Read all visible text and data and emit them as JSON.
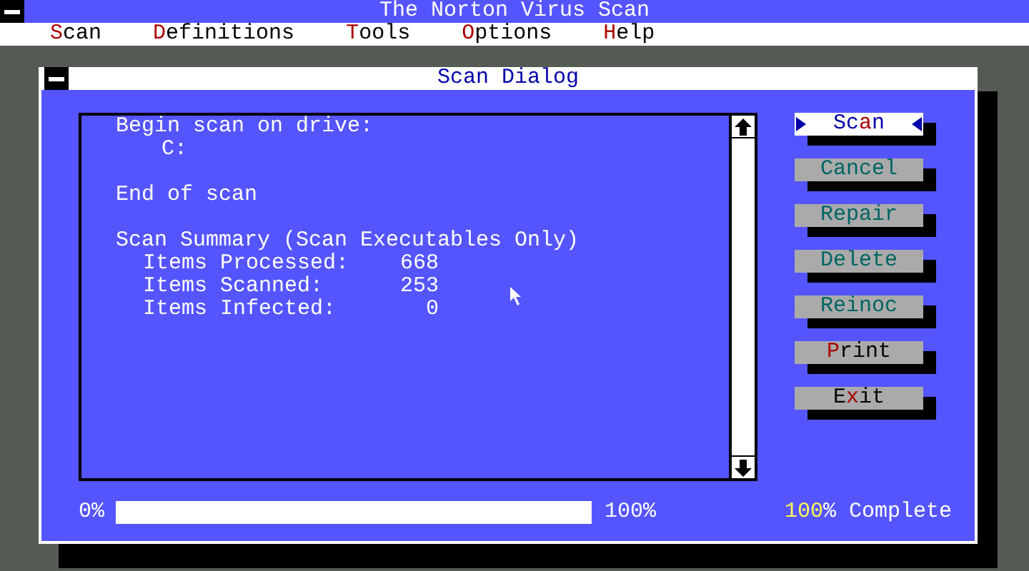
{
  "window": {
    "title": "The Norton Virus Scan"
  },
  "menu": [
    {
      "label": "**S**can"
    },
    {
      "label": "**D**efinitions"
    },
    {
      "label": "**T**ools"
    },
    {
      "label": "**O**ptions"
    },
    {
      "label": "**H**elp"
    }
  ],
  "dialog": {
    "title": "Scan Dialog",
    "log": [
      {
        "heading": "Begin scan on drive:",
        "lines": [
          "C:"
        ]
      },
      {
        "heading": "End of scan"
      },
      {
        "heading": "Scan Summary (Scan Executables Only)",
        "rows": [
          {
            "label": "Items Processed:",
            "value": "668"
          },
          {
            "label": "Items Scanned:",
            "value": "253"
          },
          {
            "label": "Items Infected:",
            "value": "0"
          }
        ]
      }
    ],
    "buttons": [
      {
        "label": "Sc**a**n",
        "selected": true,
        "disabled": false
      },
      {
        "label": "Cancel",
        "selected": false,
        "disabled": true
      },
      {
        "label": "Repair",
        "selected": false,
        "disabled": true
      },
      {
        "label": "Delete",
        "selected": false,
        "disabled": true
      },
      {
        "label": "Reinoc",
        "selected": false,
        "disabled": true
      },
      {
        "label": "**P**rint",
        "selected": false,
        "disabled": false
      },
      {
        "label": "E**x**it",
        "selected": false,
        "disabled": false
      }
    ],
    "progress": {
      "min_label": "0%",
      "max_label": "100%",
      "level": 1.0,
      "status": "**100**% Complete"
    }
  }
}
